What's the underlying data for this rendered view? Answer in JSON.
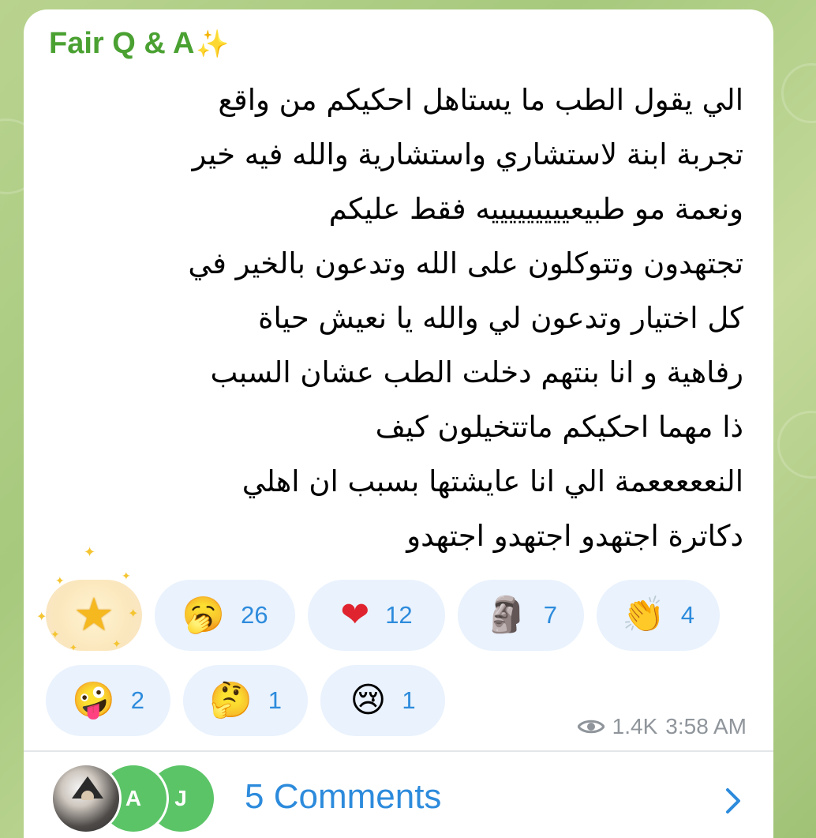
{
  "message": {
    "sender": "Fair Q & A",
    "sender_icon": "sparkles-icon",
    "lines": [
      "الي يقول الطب ما يستاهل احكيكم من واقع",
      "تجربة ابنة لاستشاري واستشارية والله فيه خير",
      "ونعمة مو طبيعيييييييييه فقط عليكم",
      "تجتهدون وتتوكلون على الله وتدعون بالخير في",
      "كل اختيار وتدعون لي والله يا نعيش حياة",
      "رفاهية و انا بنتهم دخلت الطب عشان السبب",
      "ذا مهما احكيكم ماتتخيلون كيف",
      "النعععععمة الي انا عايشتها بسبب ان اهلي",
      "دكاترة اجتهدو اجتهدو اجتهدو"
    ]
  },
  "reactions": {
    "star": {
      "icon": "star-icon"
    },
    "row1": [
      {
        "emoji": "🥱",
        "name": "yawning-face-emoji",
        "count": "26"
      },
      {
        "emoji": "❤",
        "name": "red-heart-emoji",
        "count": "12"
      },
      {
        "emoji": "🗿",
        "name": "moai-emoji",
        "count": "7"
      },
      {
        "emoji": "👏",
        "name": "clapping-hands-emoji",
        "count": "4"
      }
    ],
    "row2": [
      {
        "emoji": "🤪",
        "name": "zany-face-emoji",
        "count": "2"
      },
      {
        "emoji": "🤔",
        "name": "thinking-face-emoji",
        "count": "1"
      },
      {
        "emoji": "😢",
        "name": "crying-face-emoji",
        "count": "1"
      }
    ]
  },
  "meta": {
    "views": "1.4K",
    "time": "3:58 AM"
  },
  "comments": {
    "label": "5 Comments",
    "avatars": [
      "A",
      "J"
    ]
  },
  "colors": {
    "sender": "#4aa132",
    "accent": "#2d8bdc",
    "reaction_bg": "#e9f2fd"
  }
}
